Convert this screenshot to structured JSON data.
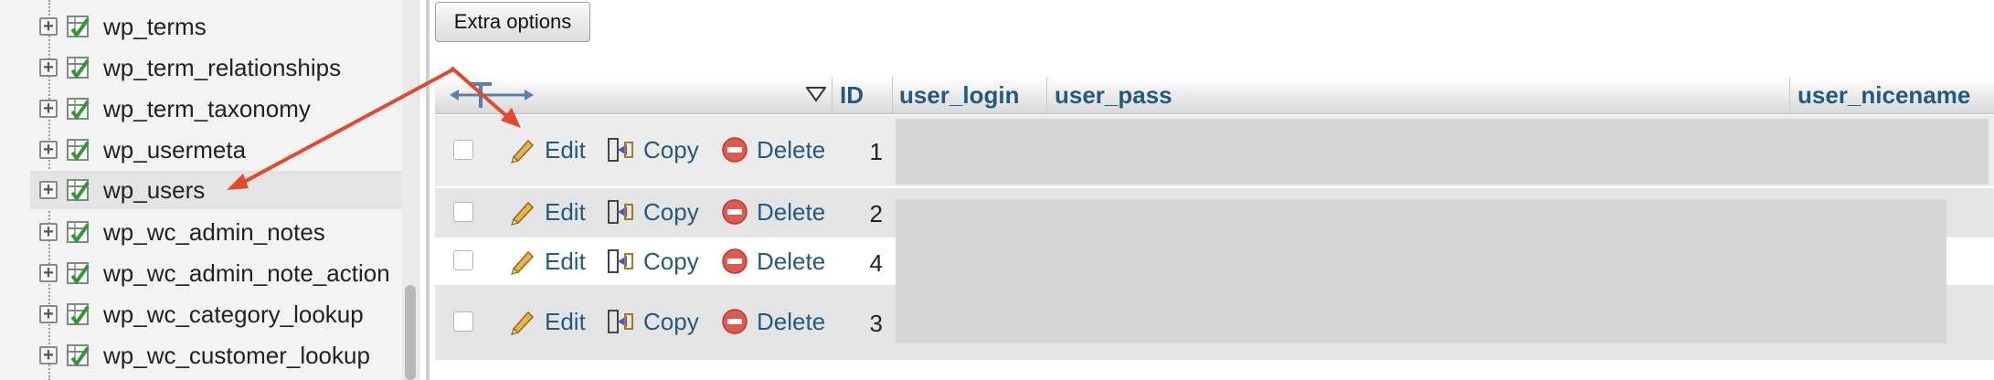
{
  "sidebar": {
    "items": [
      {
        "label": "wp_terms"
      },
      {
        "label": "wp_term_relationships"
      },
      {
        "label": "wp_term_taxonomy"
      },
      {
        "label": "wp_usermeta"
      },
      {
        "label": "wp_users"
      },
      {
        "label": "wp_wc_admin_notes"
      },
      {
        "label": "wp_wc_admin_note_action"
      },
      {
        "label": "wp_wc_category_lookup"
      },
      {
        "label": "wp_wc_customer_lookup"
      }
    ]
  },
  "toolbar": {
    "extra_options_label": "Extra options"
  },
  "table": {
    "columns": [
      "ID",
      "user_login",
      "user_pass",
      "user_nicename"
    ],
    "action_labels": {
      "edit": "Edit",
      "copy": "Copy",
      "delete": "Delete"
    },
    "rows": [
      {
        "id": "1"
      },
      {
        "id": "2"
      },
      {
        "id": "4"
      },
      {
        "id": "3"
      }
    ]
  },
  "colors": {
    "link": "#235a81",
    "annotation_arrow": "#e2492f",
    "delete_icon": "#d9534f"
  }
}
